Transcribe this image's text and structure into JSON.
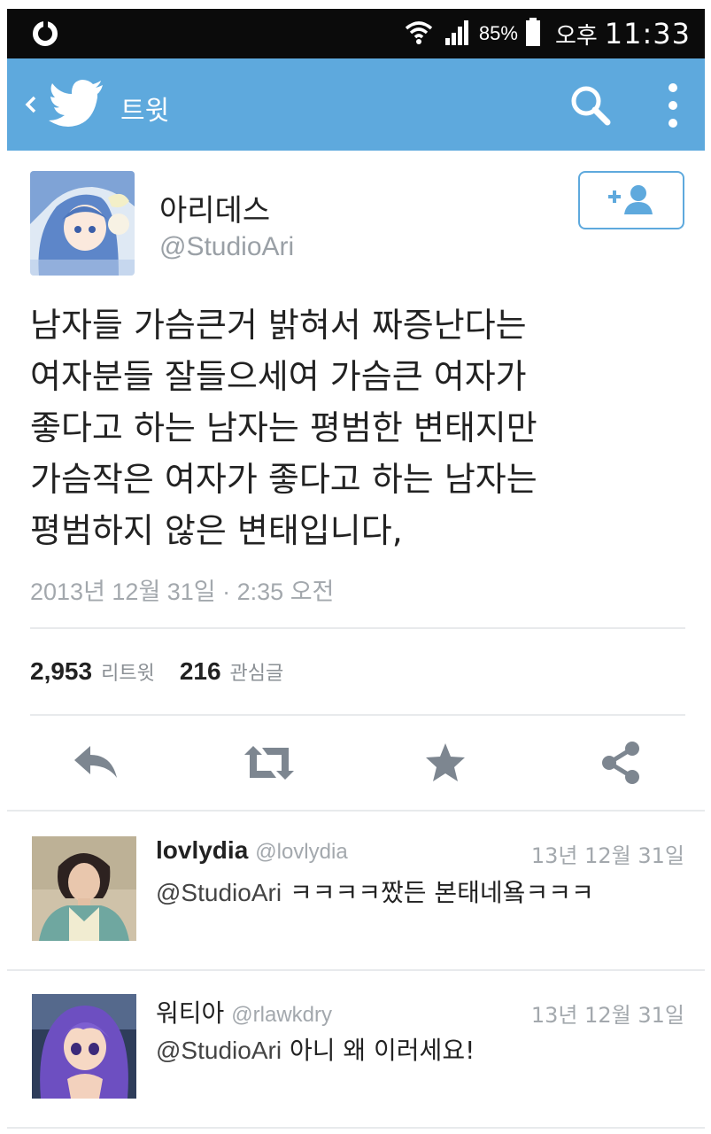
{
  "status_bar": {
    "battery": "85%",
    "ampm": "오후",
    "time": "11:33",
    "icons": [
      "carrier-icon",
      "wifi-icon",
      "signal-icon",
      "battery-icon"
    ]
  },
  "app_bar": {
    "title": "트윗",
    "color": "#5ea9dd",
    "icons": [
      "back-icon",
      "twitter-bird-icon",
      "search-icon",
      "more-icon"
    ]
  },
  "tweet": {
    "author_name": "아리데스",
    "author_handle": "@StudioAri",
    "lines": [
      "남자들 가슴큰거 밝혀서 짜증난다는",
      "여자분들 잘들으세여 가슴큰 여자가",
      "좋다고 하는 남자는 평범한 변태지만",
      "가슴작은 여자가 좋다고 하는 남자는",
      "평범하지 않은 변태입니다,"
    ],
    "timestamp": "2013년 12월 31일 · 2:35 오전",
    "retweet_count": "2,953",
    "retweet_label": "리트윗",
    "favorite_count": "216",
    "favorite_label": "관심글",
    "actions": [
      "reply-icon",
      "retweet-icon",
      "favorite-icon",
      "share-icon"
    ]
  },
  "replies": [
    {
      "name": "lovlydia",
      "handle": "@lovlydia",
      "date": "13년 12월 31일",
      "mention": "@StudioAri",
      "text": "ㅋㅋㅋㅋ짰든 본태네욬ㅋㅋㅋ"
    },
    {
      "name": "워티아",
      "handle": "@rlawkdry",
      "date": "13년 12월 31일",
      "mention": "@StudioAri",
      "text": "아니 왜 이러세요!"
    }
  ]
}
